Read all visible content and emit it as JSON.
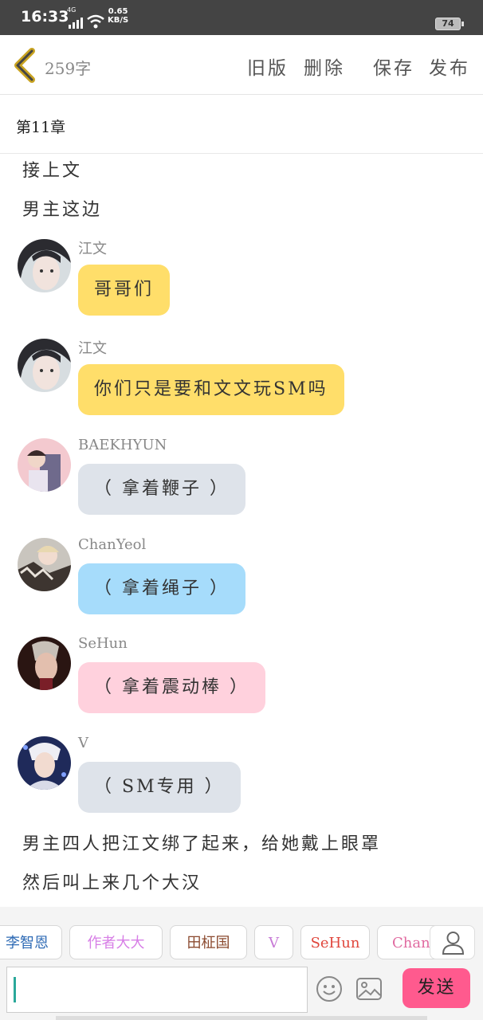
{
  "status_bar": {
    "time": "16:33",
    "signal": "4G",
    "speed_value": "0.65",
    "speed_unit": "KB/S",
    "battery": "74"
  },
  "toolbar": {
    "word_count": "259字",
    "old_version": "旧版",
    "delete": "删除",
    "save": "保存",
    "publish": "发布"
  },
  "chapter": {
    "title": "第11章"
  },
  "narration_top": [
    "接上文",
    "男主这边"
  ],
  "messages": [
    {
      "sender": "江文",
      "text": "哥哥们",
      "bubble_color": "#ffde6a"
    },
    {
      "sender": "江文",
      "text": "你们只是要和文文玩SM吗",
      "bubble_color": "#ffde6a"
    },
    {
      "sender": "BAEKHYUN",
      "text": "（ 拿着鞭子 ）",
      "bubble_color": "#dee3ea"
    },
    {
      "sender": "ChanYeol",
      "text": "（ 拿着绳子 ）",
      "bubble_color": "#a6dcfb"
    },
    {
      "sender": "SeHun",
      "text": "（ 拿着震动棒 ）",
      "bubble_color": "#ffd1dd"
    },
    {
      "sender": "V",
      "text": "（ SM专用 ）",
      "bubble_color": "#dee3ea"
    }
  ],
  "narration_bottom": [
    "男主四人把江文绑了起来，给她戴上眼罩",
    "然后叫上来几个大汉"
  ],
  "quick_chars": [
    {
      "name": "李智恩",
      "color": "#2f6bb5"
    },
    {
      "name": "作者大大",
      "color": "#d77ee6"
    },
    {
      "name": "田柾国",
      "color": "#8b4a2f"
    },
    {
      "name": "V",
      "color": "#c77ad6"
    },
    {
      "name": "SeHun",
      "color": "#e0463c"
    },
    {
      "name": "ChanYeol",
      "color": "#e06aa0"
    }
  ],
  "input": {
    "placeholder": ""
  },
  "send_label": "发送"
}
